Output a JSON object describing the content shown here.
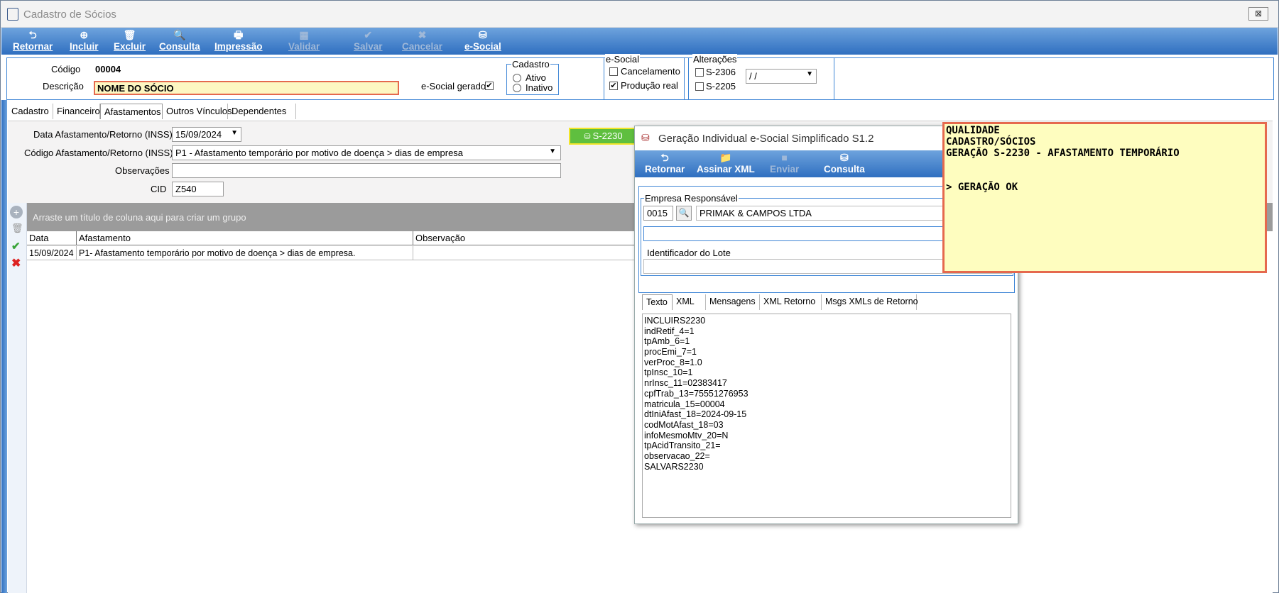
{
  "window": {
    "title": "Cadastro de Sócios",
    "close": "⊠"
  },
  "toolbar": [
    {
      "label": "Retornar",
      "icon": "return-icon",
      "glyph": "⮌",
      "enabled": true
    },
    {
      "label": "Incluir",
      "icon": "add-icon",
      "glyph": "⊕",
      "enabled": true
    },
    {
      "label": "Excluir",
      "icon": "trash-icon",
      "glyph": "🗑",
      "enabled": true
    },
    {
      "label": "Consulta",
      "icon": "search-icon",
      "glyph": "🔍",
      "enabled": true
    },
    {
      "label": "Impressão",
      "icon": "printer-icon",
      "glyph": "🖶",
      "enabled": true
    },
    {
      "label": "Validar",
      "icon": "validate-icon",
      "glyph": "▦",
      "enabled": false
    },
    {
      "label": "Salvar",
      "icon": "check-icon",
      "glyph": "✔",
      "enabled": false
    },
    {
      "label": "Cancelar",
      "icon": "x-icon",
      "glyph": "✖",
      "enabled": false
    },
    {
      "label": "e-Social",
      "icon": "esocial-icon",
      "glyph": "⛁",
      "enabled": true
    }
  ],
  "header": {
    "codigo_label": "Código",
    "codigo_value": "00004",
    "descricao_label": "Descrição",
    "descricao_value": "NOME DO SÓCIO",
    "esocial_gerado_label": "e-Social gerado",
    "esocial_gerado_checked": true,
    "cadastro_group": "Cadastro",
    "ativo_label": "Ativo",
    "inativo_label": "Inativo",
    "esocial_group": "e-Social",
    "cancelamento_label": "Cancelamento",
    "producao_label": "Produção real",
    "alteracoes_group": "Alterações",
    "s2306_label": "S-2306",
    "s2205_label": "S-2205",
    "date_value": " / /"
  },
  "tabs": [
    "Cadastro",
    "Financeiro",
    "Afastamentos",
    "Outros Vínculos",
    "Dependentes"
  ],
  "afastamento": {
    "data_label": "Data Afastamento/Retorno (INSS)",
    "data_value": "15/09/2024",
    "codigo_label": "Código  Afastamento/Retorno (INSS)",
    "codigo_value": "P1 - Afastamento temporário por motivo de doença >  dias de empresa",
    "obs_label": "Observações",
    "obs_value": "",
    "cid_label": "CID",
    "cid_value": "Z540",
    "s2230_button": "S-2230"
  },
  "grid": {
    "groupbar_text": "Arraste um título de coluna aqui para criar um grupo",
    "columns": [
      "Data",
      "Afastamento",
      "Observação"
    ],
    "rows": [
      {
        "data": "15/09/2024",
        "afastamento": "P1- Afastamento temporário por motivo de doença > dias de empresa.",
        "observacao": ""
      }
    ]
  },
  "dialog": {
    "title": "Geração Individual e-Social Simplificado S1.2",
    "toolbar": [
      {
        "label": "Retornar",
        "icon": "return-icon",
        "glyph": "⮌",
        "enabled": true
      },
      {
        "label": "Assinar XML",
        "icon": "folder-sign-icon",
        "glyph": "📁",
        "enabled": true
      },
      {
        "label": "Enviar",
        "icon": "send-icon",
        "glyph": "■",
        "enabled": false
      },
      {
        "label": "Consulta",
        "icon": "query-icon",
        "glyph": "⛁",
        "enabled": true
      }
    ],
    "empresa_group": "Empresa Responsável",
    "empresa_code": "0015",
    "empresa_name": "PRIMAK & CAMPOS LTDA",
    "lote_label": "Identificador do Lote",
    "lote_value": "",
    "tabs": [
      "Texto",
      "XML",
      "Mensagens",
      "XML Retorno",
      "Msgs XMLs de Retorno"
    ],
    "text_lines": [
      "INCLUIRS2230",
      "indRetif_4=1",
      "tpAmb_6=1",
      "procEmi_7=1",
      "verProc_8=1.0",
      "tpInsc_10=1",
      "nrInsc_11=02383417",
      "cpfTrab_13=75551276953",
      "matricula_15=00004",
      "dtIniAfast_18=2024-09-15",
      "codMotAfast_18=03",
      "infoMesmoMtv_20=N",
      "tpAcidTransito_21=",
      "observacao_22=",
      "SALVARS2230"
    ]
  },
  "note": {
    "lines": [
      "QUALIDADE",
      "CADASTRO/SÓCIOS",
      "GERAÇÃO S-2230 - AFASTAMENTO TEMPORÁRIO",
      "",
      "",
      "> GERAÇÃO OK"
    ]
  },
  "colors": {
    "accent": "#2f6fc0",
    "highlight_border": "#e5694e",
    "note_bg": "#fefdbf",
    "field_highlight": "#fdf7c2"
  }
}
